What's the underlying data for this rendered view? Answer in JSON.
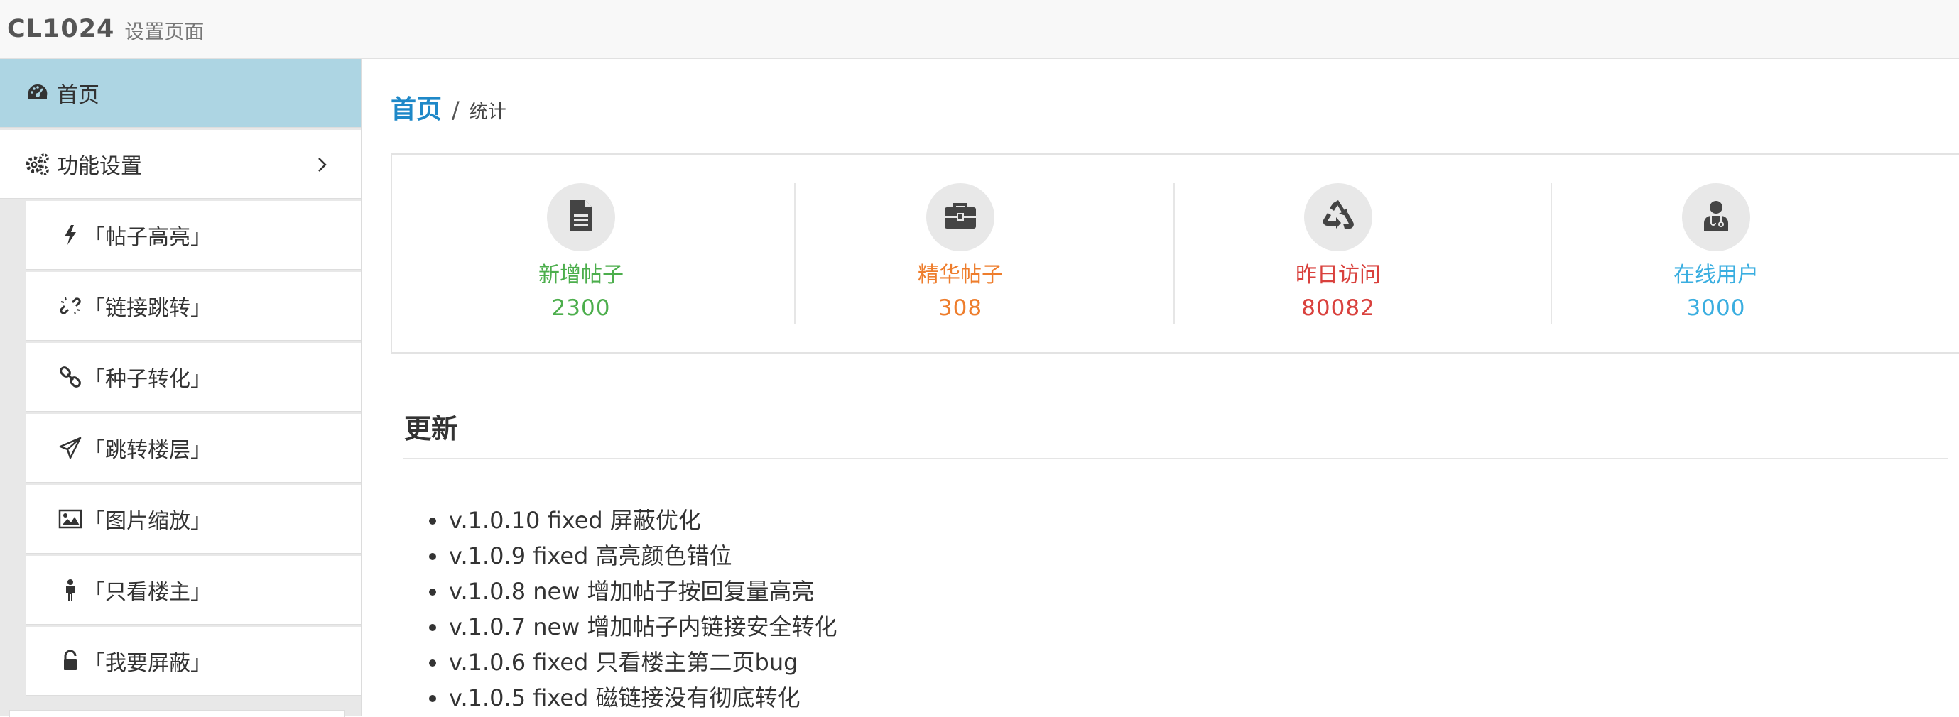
{
  "header": {
    "brand": "CL1024",
    "subtitle": "设置页面"
  },
  "sidebar": {
    "items": [
      {
        "label": "首页",
        "icon": "dashboard-icon",
        "active": true
      },
      {
        "label": "功能设置",
        "icon": "cogs-icon",
        "expandable": true
      }
    ],
    "subitems": [
      {
        "label": "「帖子高亮」",
        "icon": "bolt-icon"
      },
      {
        "label": "「链接跳转」",
        "icon": "unlink-icon"
      },
      {
        "label": "「种子转化」",
        "icon": "link-icon"
      },
      {
        "label": "「跳转楼层」",
        "icon": "paper-plane-icon"
      },
      {
        "label": "「图片缩放」",
        "icon": "image-icon"
      },
      {
        "label": "「只看楼主」",
        "icon": "person-icon"
      },
      {
        "label": "「我要屏蔽」",
        "icon": "unlock-icon"
      }
    ]
  },
  "breadcrumb": {
    "home": "首页",
    "separator": "/",
    "current": "统计"
  },
  "stats": [
    {
      "label": "新增帖子",
      "value": "2300",
      "icon": "file-text-icon",
      "color": "#4cae4c"
    },
    {
      "label": "精华帖子",
      "value": "308",
      "icon": "briefcase-icon",
      "color": "#ee7d2c"
    },
    {
      "label": "昨日访问",
      "value": "80082",
      "icon": "recycle-icon",
      "color": "#d9413d"
    },
    {
      "label": "在线用户",
      "value": "3000",
      "icon": "user-doctor-icon",
      "color": "#3aaee0"
    }
  ],
  "updates": {
    "title": "更新",
    "items": [
      "v.1.0.10 fixed 屏蔽优化",
      "v.1.0.9 fixed 高亮颜色错位",
      "v.1.0.8 new 增加帖子按回复量高亮",
      "v.1.0.7 new 增加帖子内链接安全转化",
      "v.1.0.6 fixed 只看楼主第二页bug",
      "v.1.0.5 fixed 磁链接没有彻底转化"
    ]
  },
  "colors": {
    "accent": "#1e88c8",
    "active_nav_bg": "#add5e3"
  }
}
